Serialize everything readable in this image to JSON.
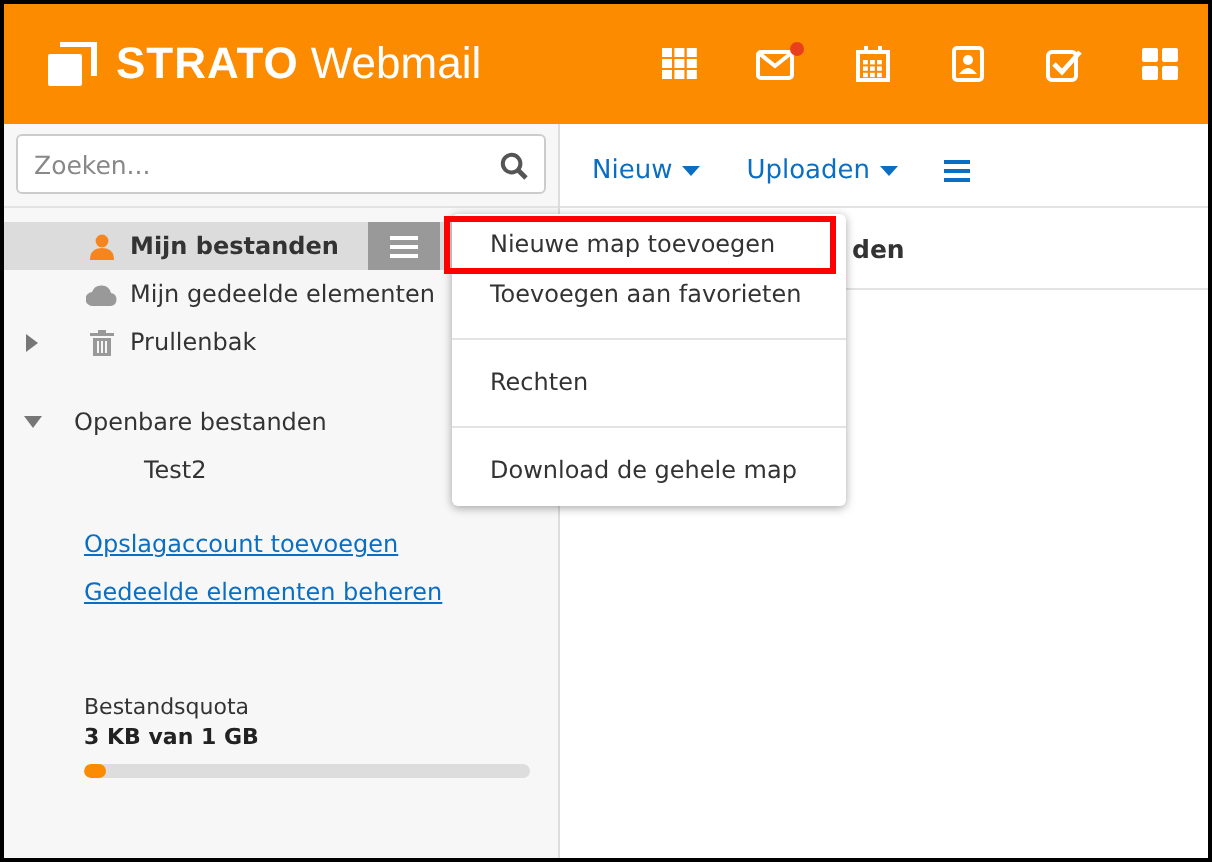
{
  "header": {
    "brand": "STRATO",
    "product": "Webmail",
    "apps": [
      {
        "kind": "grid",
        "notify": false
      },
      {
        "kind": "mail",
        "notify": true
      },
      {
        "kind": "calendar",
        "notify": false
      },
      {
        "kind": "contacts",
        "notify": false
      },
      {
        "kind": "tasks",
        "notify": false
      },
      {
        "kind": "tiles",
        "notify": false
      }
    ]
  },
  "search": {
    "placeholder": "Zoeken..."
  },
  "toolbar": [
    {
      "label": "Nieuw",
      "kind": "dropdown"
    },
    {
      "label": "Uploaden",
      "kind": "dropdown"
    },
    {
      "kind": "menu"
    }
  ],
  "tree": [
    {
      "label": "Mijn bestanden",
      "kind": "personal",
      "selected": true
    },
    {
      "label": "Mijn gedeelde elementen",
      "kind": "shared",
      "selected": false
    },
    {
      "label": "Prullenbak",
      "kind": "trash",
      "selected": false,
      "expanded": false
    }
  ],
  "public": {
    "label": "Openbare bestanden",
    "expanded": true,
    "children": [
      {
        "label": "Test2",
        "selected": false
      }
    ]
  },
  "links": [
    "Opslagaccount toevoegen",
    "Gedeelde elementen beheren"
  ],
  "quota": {
    "title": "Bestandsquota",
    "usage": "3 KB van 1 GB",
    "level": 0.05
  },
  "content": {
    "column_1": "den"
  },
  "context_menu": [
    {
      "label": "Nieuwe map toevoegen",
      "highlighted": true
    },
    {
      "label": "Toevoegen aan favorieten",
      "highlighted": false
    },
    {
      "label": "Rechten",
      "highlighted": false
    },
    {
      "label": "Download de gehele map",
      "highlighted": false
    }
  ]
}
